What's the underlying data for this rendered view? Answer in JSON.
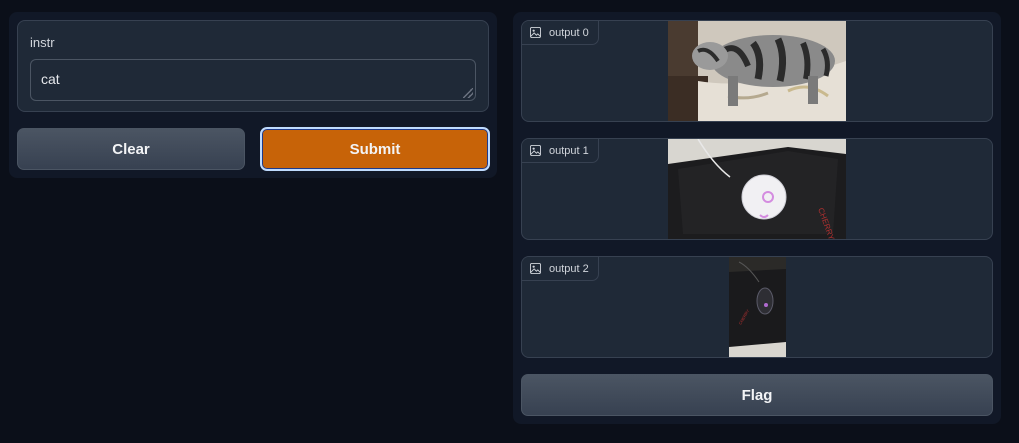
{
  "input": {
    "label": "instr",
    "value": "cat"
  },
  "buttons": {
    "clear_label": "Clear",
    "submit_label": "Submit",
    "flag_label": "Flag"
  },
  "outputs": [
    {
      "label": "output 0",
      "icon": "image-icon",
      "content": "photo of a striped tabby cat on a bed"
    },
    {
      "label": "output 1",
      "icon": "image-icon",
      "content": "photo of a white mouse on a black mousepad"
    },
    {
      "label": "output 2",
      "icon": "image-icon",
      "content": "photo of a dark mouse on a black mousepad"
    }
  ],
  "colors": {
    "submit": "#c76308",
    "background": "#0b0f19",
    "panel": "#111827",
    "block": "#1f2937"
  }
}
